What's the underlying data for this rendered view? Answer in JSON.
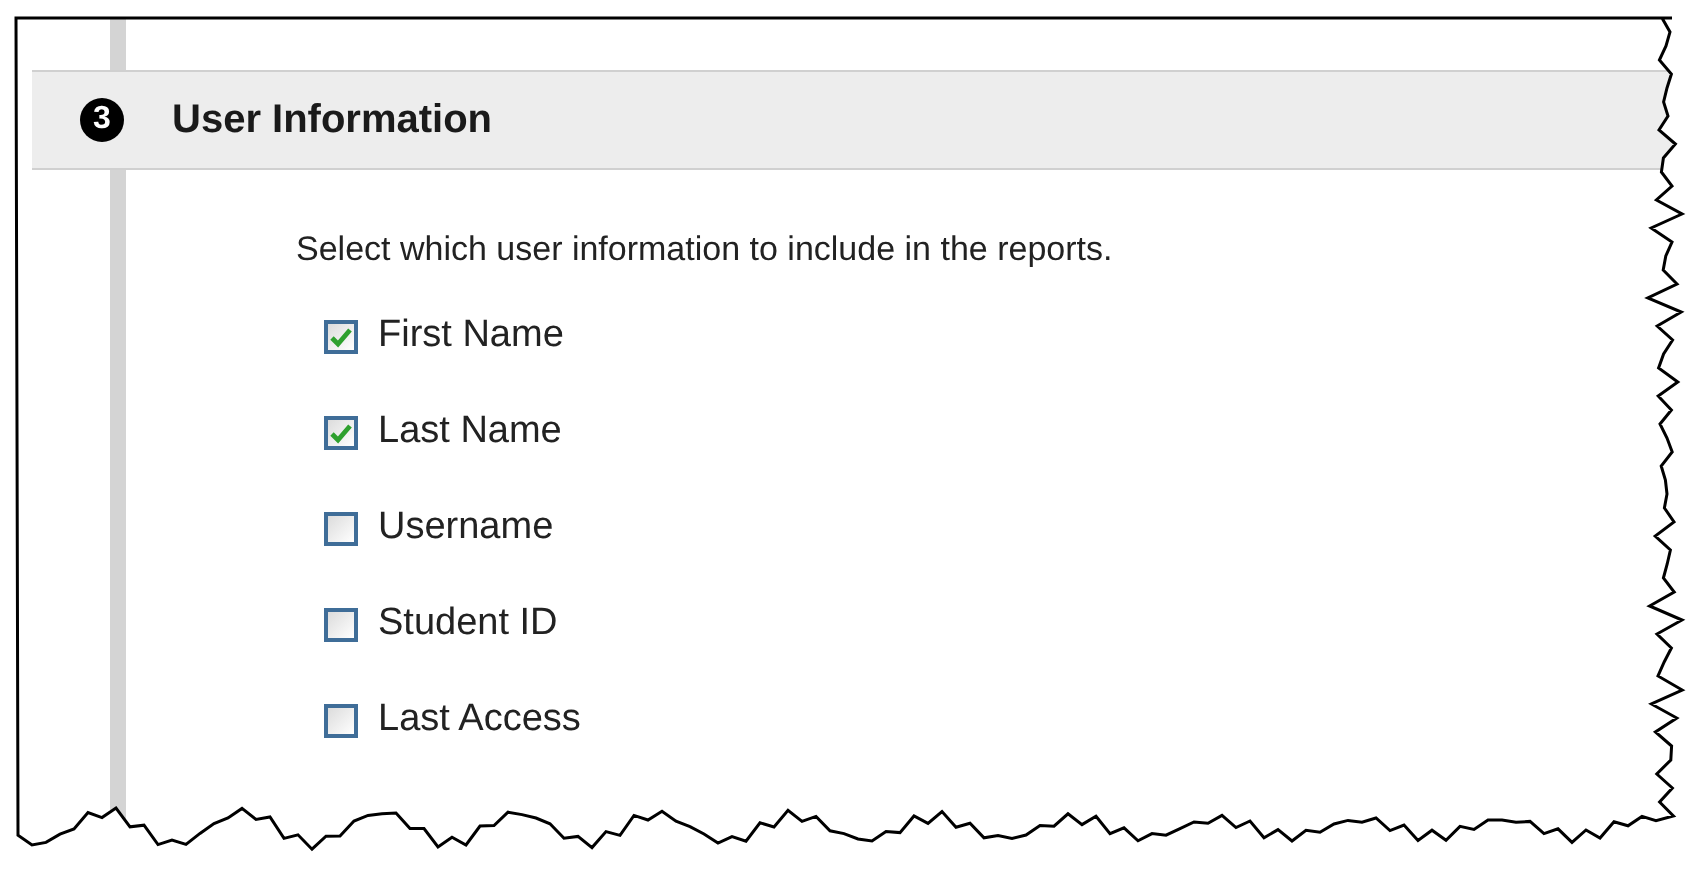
{
  "section": {
    "number": "3",
    "title": "User Information"
  },
  "instruction": "Select which user information to include in the reports.",
  "options": [
    {
      "label": "First Name",
      "checked": true
    },
    {
      "label": "Last Name",
      "checked": true
    },
    {
      "label": "Username",
      "checked": false
    },
    {
      "label": "Student ID",
      "checked": false
    },
    {
      "label": "Last Access",
      "checked": false
    }
  ]
}
